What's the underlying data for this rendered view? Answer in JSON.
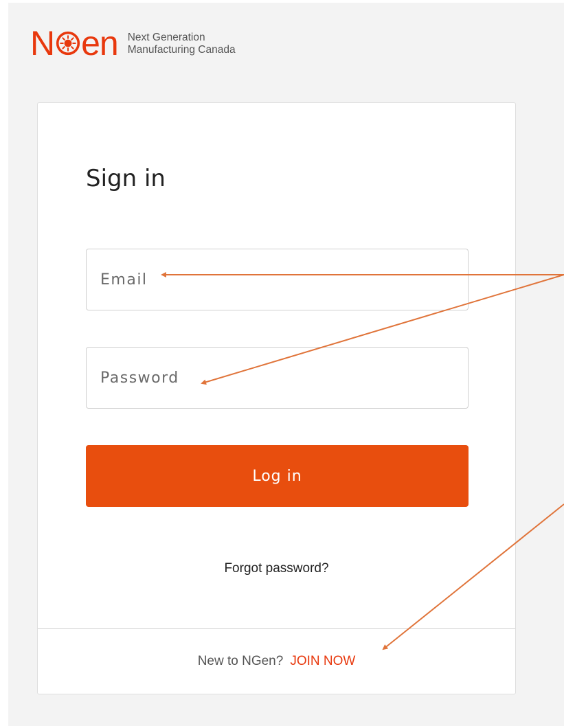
{
  "logo": {
    "wordmark_start": "N",
    "wordmark_end": "en",
    "tagline_line1": "Next Generation",
    "tagline_line2": "Manufacturing Canada"
  },
  "form": {
    "title": "Sign in",
    "email_placeholder": "Email",
    "password_placeholder": "Password",
    "login_label": "Log in",
    "forgot_label": "Forgot password?"
  },
  "footer": {
    "prompt": "New to NGen?",
    "join_label": "JOIN NOW"
  },
  "colors": {
    "brand": "#e8380d",
    "button": "#e84e0e",
    "annotation_arrow": "#e0743a",
    "background": "#f3f3f3"
  },
  "icons": {
    "logo_mark": "gear-burst-icon"
  }
}
